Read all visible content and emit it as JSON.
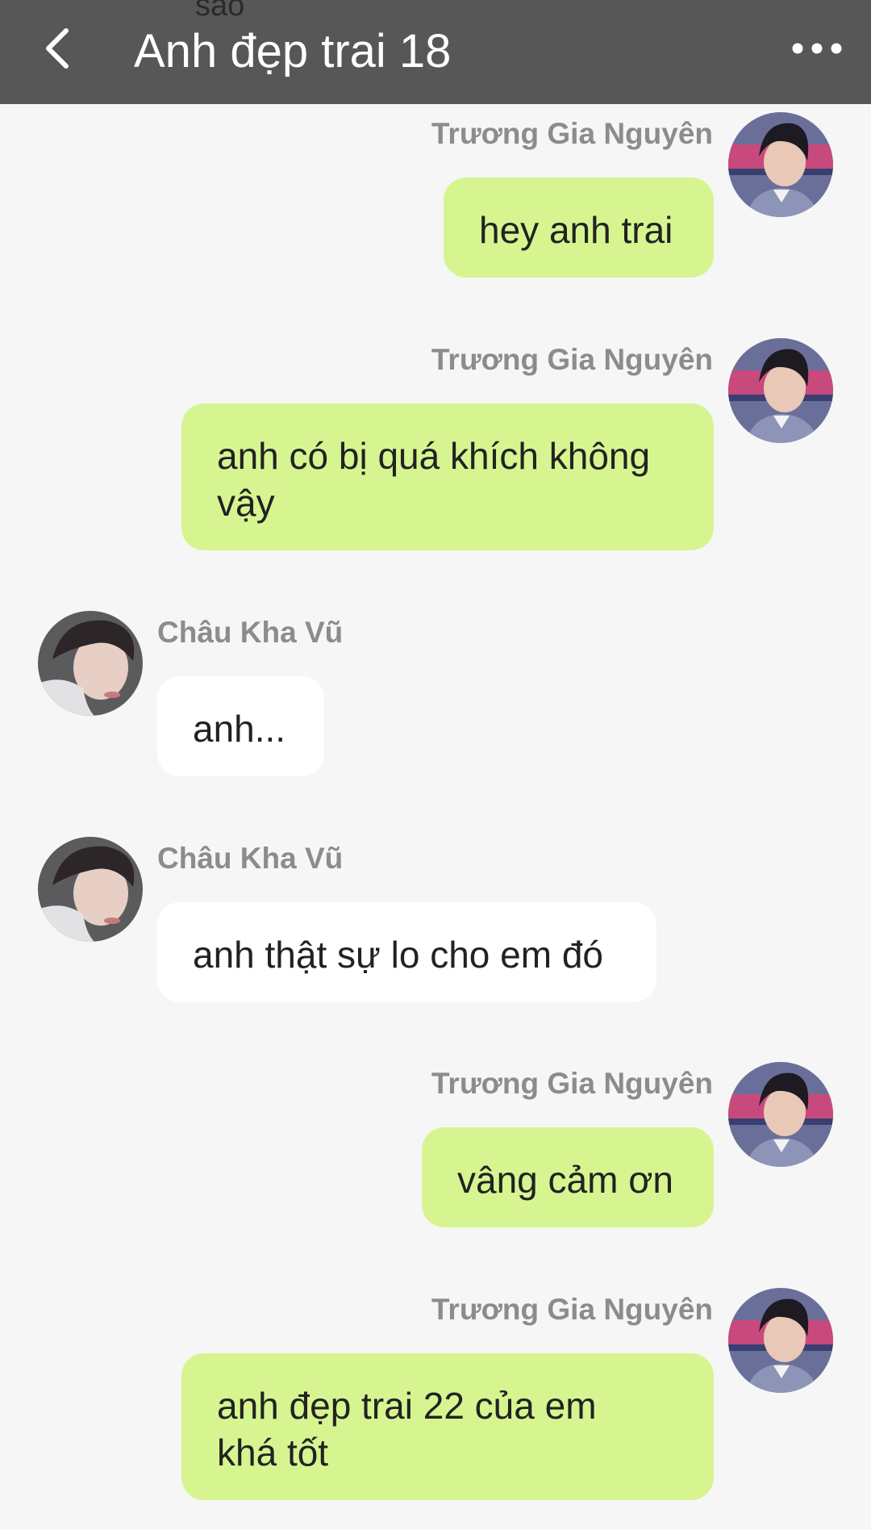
{
  "header": {
    "peek_text": "sao",
    "title": "Anh đẹp trai 18",
    "back_icon": "chevron-left-icon",
    "more_icon": "more-horizontal-icon",
    "background": "#575757"
  },
  "colors": {
    "outgoing_bubble": "#d6f590",
    "incoming_bubble": "#ffffff",
    "name_text": "#8c8c8c",
    "page_background": "#f6f6f6"
  },
  "messages": [
    {
      "sender": "Trương Gia Nguyên",
      "text": "hey anh trai",
      "direction": "outgoing"
    },
    {
      "sender": "Trương Gia Nguyên",
      "text": "anh có bị quá khích không vậy",
      "direction": "outgoing"
    },
    {
      "sender": "Châu Kha Vũ",
      "text": "anh...",
      "direction": "incoming"
    },
    {
      "sender": "Châu Kha Vũ",
      "text": "anh thật sự lo cho em đó",
      "direction": "incoming"
    },
    {
      "sender": "Trương Gia Nguyên",
      "text": "vâng cảm ơn",
      "direction": "outgoing"
    },
    {
      "sender": "Trương Gia Nguyên",
      "text": "anh đẹp trai 22 của em khá tốt",
      "direction": "outgoing"
    }
  ]
}
